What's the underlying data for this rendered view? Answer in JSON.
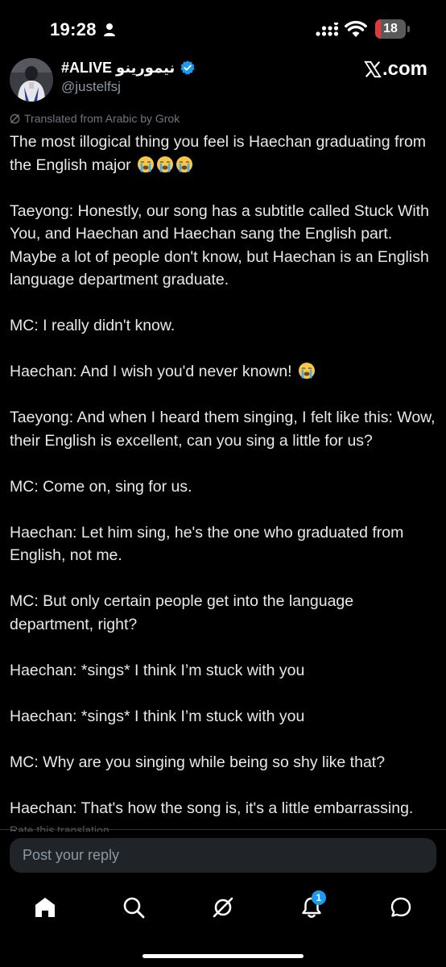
{
  "status_bar": {
    "time": "19:28",
    "battery": "18",
    "battery_level": 0.18
  },
  "author": {
    "display_name": "#ALIVE نيمورينو",
    "handle": "@justelfsj"
  },
  "watermark": "X.com",
  "translation_label": "Translated from Arabic by Grok",
  "tweet": {
    "line_0": "The most illogical thing you feel is Haechan graduating from the English major",
    "line_1": "Taeyong: Honestly, our song has a subtitle called Stuck With You, and Haechan and Haechan sang the English part. Maybe a lot of people don't know, but Haechan is an English language department graduate.",
    "line_2": "MC: I really didn't know.",
    "line_3": "Haechan: And I wish you'd never known!",
    "line_4": "Taeyong: And when I heard them singing, I felt like this: Wow, their English is excellent, can you sing a little for us?",
    "line_5": "MC: Come on, sing for us.",
    "line_6": "Haechan: Let him sing, he's the one who graduated from English, not me.",
    "line_7": "MC: But only certain people get into the language department, right?",
    "line_8": "Haechan: *sings* I think I’m stuck with you",
    "line_9": "Haechan: *sings* I think I’m stuck with you",
    "line_10": "MC: Why are you singing while being so shy like that?",
    "line_11": "Haechan: That's how the song is, it's a little embarrassing."
  },
  "rate_translation": "Rate this translation",
  "reply": {
    "placeholder": "Post your reply"
  },
  "nav": {
    "notifications_count": "1"
  },
  "colors": {
    "background": "#000000",
    "accent": "#1d9bf0",
    "battery_low": "#e0383e",
    "emoji": "#f7c948"
  }
}
